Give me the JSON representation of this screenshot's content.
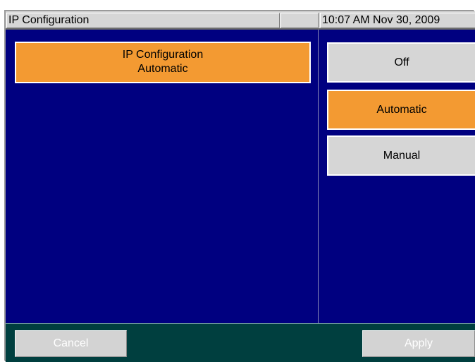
{
  "title_bar": {
    "title": "IP Configuration",
    "middle": "",
    "datetime": "10:07 AM Nov 30, 2009"
  },
  "left_panel": {
    "selected_setting": {
      "name": "IP Configuration",
      "value": "Automatic"
    }
  },
  "right_panel": {
    "options": [
      {
        "label": "Off",
        "selected": false
      },
      {
        "label": "Automatic",
        "selected": true
      },
      {
        "label": "Manual",
        "selected": false
      }
    ]
  },
  "bottom_bar": {
    "cancel_label": "Cancel",
    "apply_label": "Apply",
    "cancel_enabled": false,
    "apply_enabled": false
  },
  "colors": {
    "background": "#000080",
    "selected": "#f39a32",
    "button": "#d6d6d6",
    "bottom_bar": "#003f3f",
    "disabled_text": "#ffffff"
  }
}
